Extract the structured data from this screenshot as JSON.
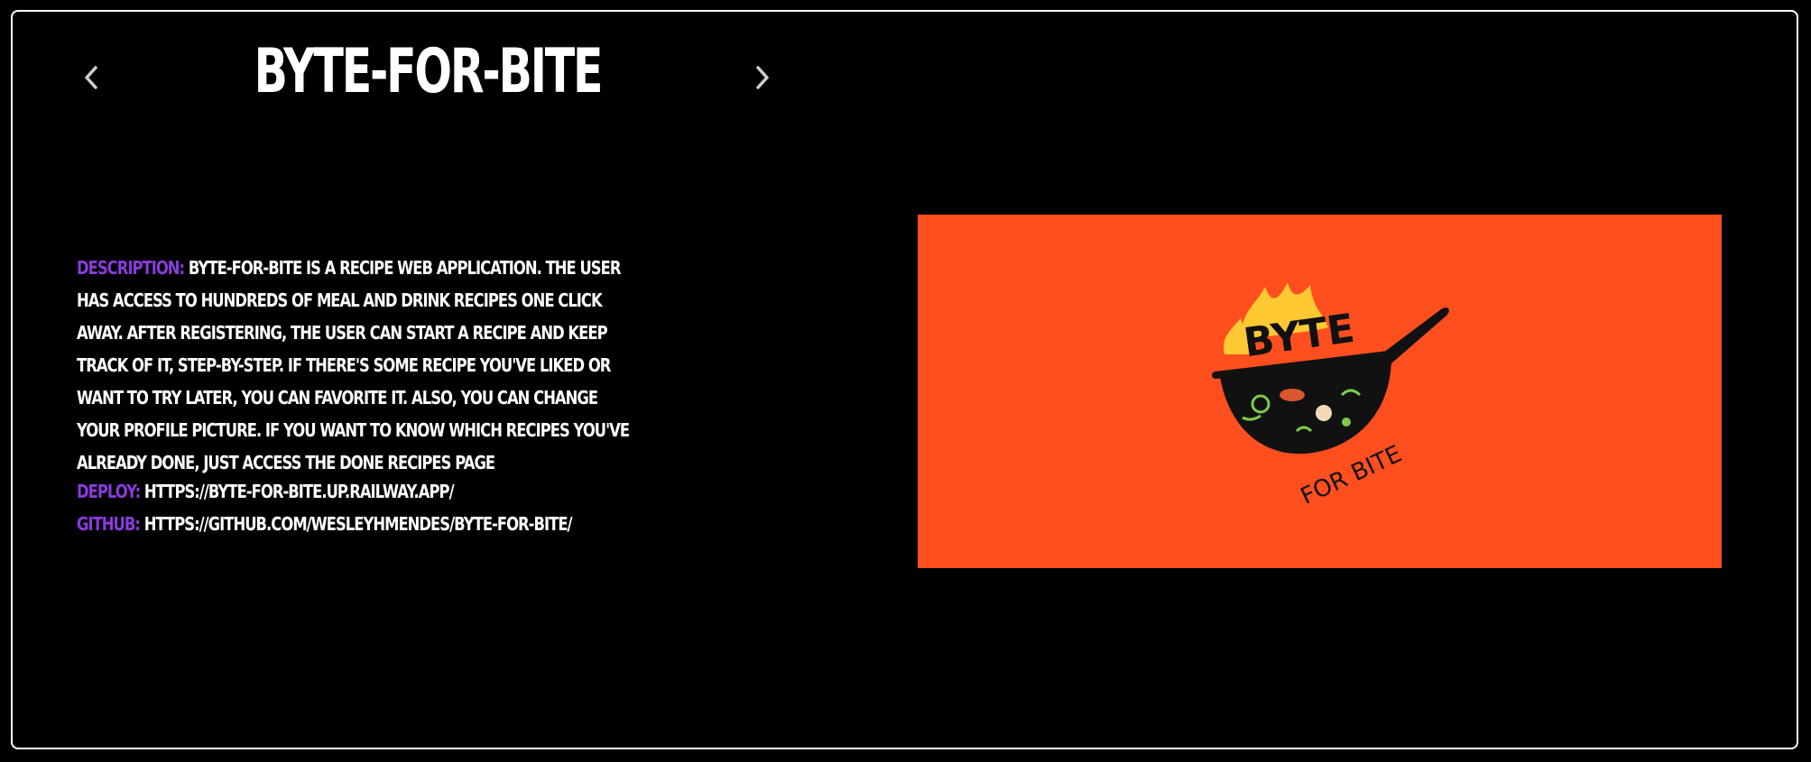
{
  "project": {
    "title": "BYTE-FOR-BITE",
    "description_label": "DESCRIPTION:",
    "description": "BYTE-FOR-BITE IS A RECIPE WEB APPLICATION. THE USER HAS ACCESS TO HUNDREDS OF MEAL AND DRINK RECIPES ONE CLICK AWAY. AFTER REGISTERING, THE USER CAN START A RECIPE AND KEEP TRACK OF IT, STEP-BY-STEP. IF THERE'S SOME RECIPE YOU'VE LIKED OR WANT TO TRY LATER, YOU CAN FAVORITE IT. ALSO, YOU CAN CHANGE YOUR PROFILE PICTURE. IF YOU WANT TO KNOW WHICH RECIPES YOU'VE ALREADY DONE, JUST ACCESS THE DONE RECIPES PAGE",
    "deploy_label": "DEPLOY:",
    "deploy_url": "HTTPS://BYTE-FOR-BITE.UP.RAILWAY.APP/",
    "github_label": "GITHUB:",
    "github_url": "HTTPS://GITHUB.COM/WESLEYHMENDES/BYTE-FOR-BITE/"
  },
  "logo": {
    "word_top": "BYTE",
    "word_bottom": "FOR BITE"
  },
  "icons": {
    "prev": "chevron-left-icon",
    "next": "chevron-right-icon"
  },
  "colors": {
    "background": "#000000",
    "frame_border": "#ffffff",
    "label_accent": "#8a3bdc",
    "preview_bg": "#ff4f1f",
    "flame": "#ffc933"
  }
}
